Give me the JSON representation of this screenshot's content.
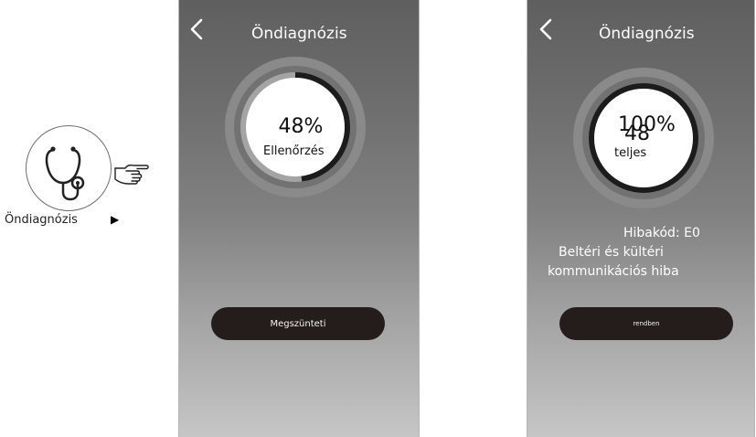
{
  "legend": {
    "icon": "stethoscope-icon",
    "pointer": "pointing-hand-icon",
    "label": "Öndiagnózis",
    "arrow": "▶"
  },
  "screen_progress": {
    "title": "Öndiagnózis",
    "percent": "48%",
    "progress_fraction": 0.48,
    "status": "Ellenőrzés",
    "button": "Megszünteti"
  },
  "screen_result": {
    "title": "Öndiagnózis",
    "percent_overlay_old": "100%",
    "percent_overlay_new": "48",
    "progress_fraction": 1.0,
    "status": "teljes",
    "error_code": "Hibakód: E0",
    "error_line_1": "Beltéri és kültéri",
    "error_line_2": "kommunikációs hiba",
    "button": "rendben"
  },
  "colors": {
    "screen_top": "#5f5f5f",
    "screen_bottom": "#c6c6c6",
    "ring_outer": "#8a8a8a",
    "ring_track": "#a4a4a4",
    "progress_arc": "#1c1c1c",
    "button_bg": "#241d1b"
  }
}
